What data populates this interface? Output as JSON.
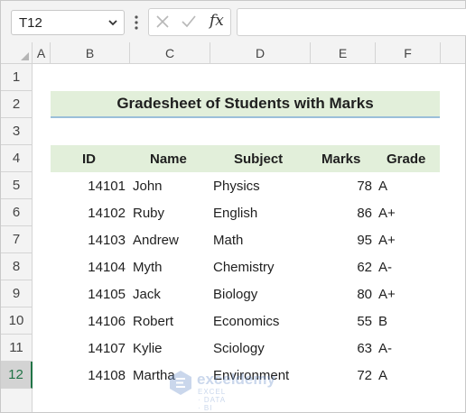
{
  "formula_bar": {
    "name_box": "T12",
    "fx_label": "fx",
    "formula_value": ""
  },
  "columns": [
    "A",
    "B",
    "C",
    "D",
    "E",
    "F"
  ],
  "rows": [
    "1",
    "2",
    "3",
    "4",
    "5",
    "6",
    "7",
    "8",
    "9",
    "10",
    "11",
    "12"
  ],
  "active_row": "12",
  "sheet": {
    "title": "Gradesheet of Students with Marks",
    "headers": {
      "id": "ID",
      "name": "Name",
      "subject": "Subject",
      "marks": "Marks",
      "grade": "Grade"
    },
    "records": [
      {
        "id": "14101",
        "name": "John",
        "subject": "Physics",
        "marks": "78",
        "grade": "A"
      },
      {
        "id": "14102",
        "name": "Ruby",
        "subject": "English",
        "marks": "86",
        "grade": "A+"
      },
      {
        "id": "14103",
        "name": "Andrew",
        "subject": "Math",
        "marks": "95",
        "grade": "A+"
      },
      {
        "id": "14104",
        "name": "Myth",
        "subject": "Chemistry",
        "marks": "62",
        "grade": "A-"
      },
      {
        "id": "14105",
        "name": "Jack",
        "subject": "Biology",
        "marks": "80",
        "grade": "A+"
      },
      {
        "id": "14106",
        "name": "Robert",
        "subject": "Economics",
        "marks": "55",
        "grade": "B"
      },
      {
        "id": "14107",
        "name": "Kylie",
        "subject": "Sciology",
        "marks": "63",
        "grade": "A-"
      },
      {
        "id": "14108",
        "name": "Martha",
        "subject": "Environment",
        "marks": "72",
        "grade": "A"
      }
    ]
  },
  "watermark": {
    "brand": "exceldemy",
    "tagline": "EXCEL · DATA · BI"
  },
  "colors": {
    "accent_green": "#217346",
    "title_fill": "#e2efda",
    "title_underline": "#9bbfd9"
  }
}
